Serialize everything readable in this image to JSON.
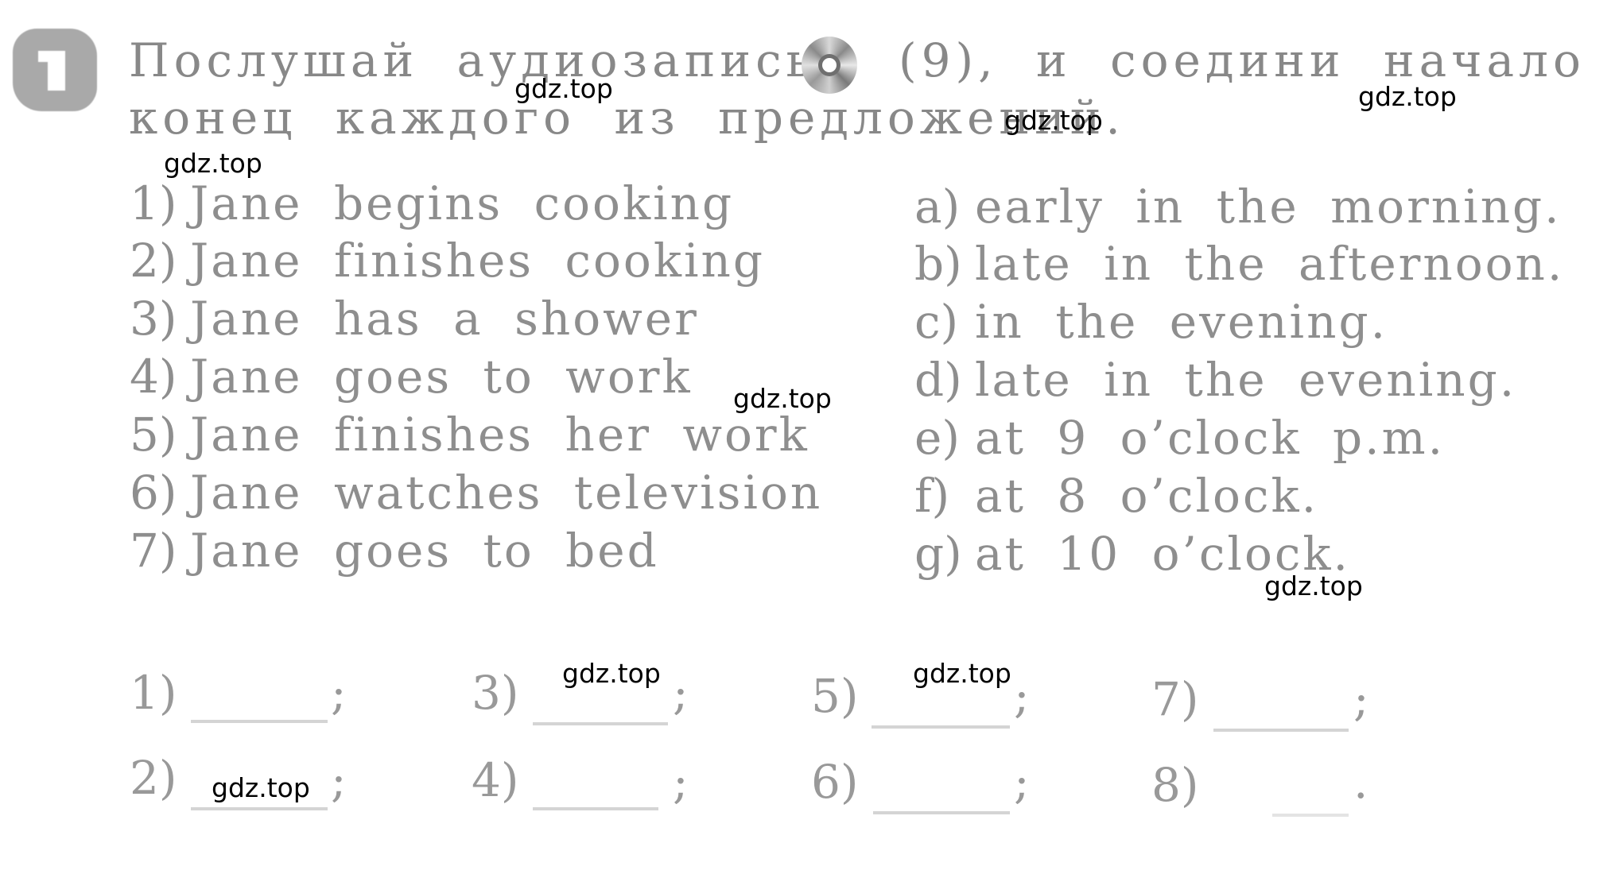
{
  "exercise": {
    "number": "1",
    "instruction_line1_a": "Послушай аудиозапись,",
    "instruction_line1_b": "(9), и соедини начало и",
    "instruction_line2": "конец каждого из предложений.",
    "audio_track": "9",
    "icons": {
      "badge": "exercise-number-badge",
      "audio": "cd-disc-icon"
    }
  },
  "sentence_beginnings": [
    {
      "num": "1)",
      "text": "Jane begins cooking"
    },
    {
      "num": "2)",
      "text": "Jane finishes cooking"
    },
    {
      "num": "3)",
      "text": "Jane has a shower"
    },
    {
      "num": "4)",
      "text": "Jane goes to work"
    },
    {
      "num": "5)",
      "text": "Jane finishes her work"
    },
    {
      "num": "6)",
      "text": "Jane watches television"
    },
    {
      "num": "7)",
      "text": "Jane goes to bed"
    }
  ],
  "sentence_endings": [
    {
      "letter": "a)",
      "text": "early in the morning."
    },
    {
      "letter": "b)",
      "text": "late in the afternoon."
    },
    {
      "letter": "c)",
      "text": "in the evening."
    },
    {
      "letter": "d)",
      "text": "late in the evening."
    },
    {
      "letter": "e)",
      "text": "at 9 o’clock p.m."
    },
    {
      "letter": "f)",
      "text": "at 8 o’clock."
    },
    {
      "letter": "g)",
      "text": "at 10 o’clock."
    }
  ],
  "answers": [
    {
      "num": "1)",
      "value": "",
      "end": ";"
    },
    {
      "num": "2)",
      "value": "",
      "end": ";"
    },
    {
      "num": "3)",
      "value": "",
      "end": ";"
    },
    {
      "num": "4)",
      "value": "",
      "end": ";"
    },
    {
      "num": "5)",
      "value": "",
      "end": ";"
    },
    {
      "num": "6)",
      "value": "",
      "end": ";"
    },
    {
      "num": "7)",
      "value": "",
      "end": ";"
    },
    {
      "num": "8)",
      "value": "",
      "end": "."
    }
  ],
  "watermark": "gdz.top"
}
